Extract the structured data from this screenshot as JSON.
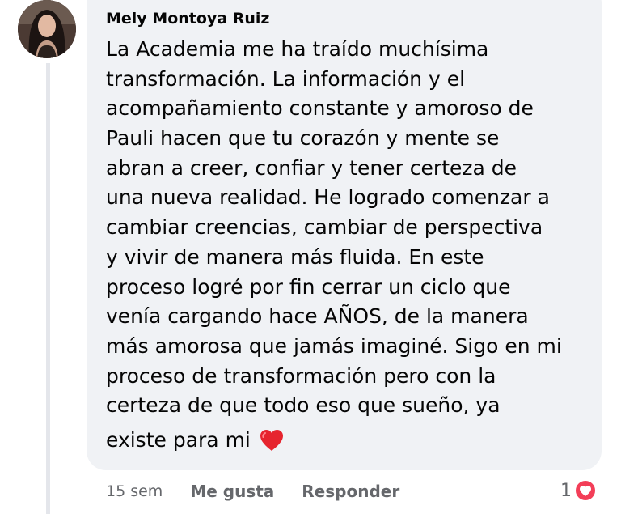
{
  "comment": {
    "author": "Mely Montoya Ruiz",
    "text_lines": [
      "La Academia me ha traído muchísima",
      "transformación. La información y el",
      "acompañamiento constante y amoroso de",
      "Pauli hacen que tu corazón y mente se",
      "abran a creer, confiar y tener certeza de",
      "una nueva realidad. He logrado comenzar a",
      "cambiar creencias, cambiar de perspectiva",
      "y vivir de manera más fluida. En este",
      "proceso logré por fin cerrar un ciclo que",
      "venía cargando hace AÑOS, de la manera",
      "más amorosa que jamás imaginé. Sigo en mi",
      "proceso de transformación pero con la",
      "certeza de que todo eso que sueño, ya"
    ],
    "last_line": "existe para mi",
    "emoji": "red-heart",
    "timestamp": "15 sem",
    "like_label": "Me gusta",
    "reply_label": "Responder",
    "reaction_count": "1",
    "reaction_type": "love"
  },
  "colors": {
    "bubble_bg": "#f0f2f5",
    "text": "#050505",
    "secondary_text": "#65676b",
    "love_reaction": "#f33e58"
  }
}
